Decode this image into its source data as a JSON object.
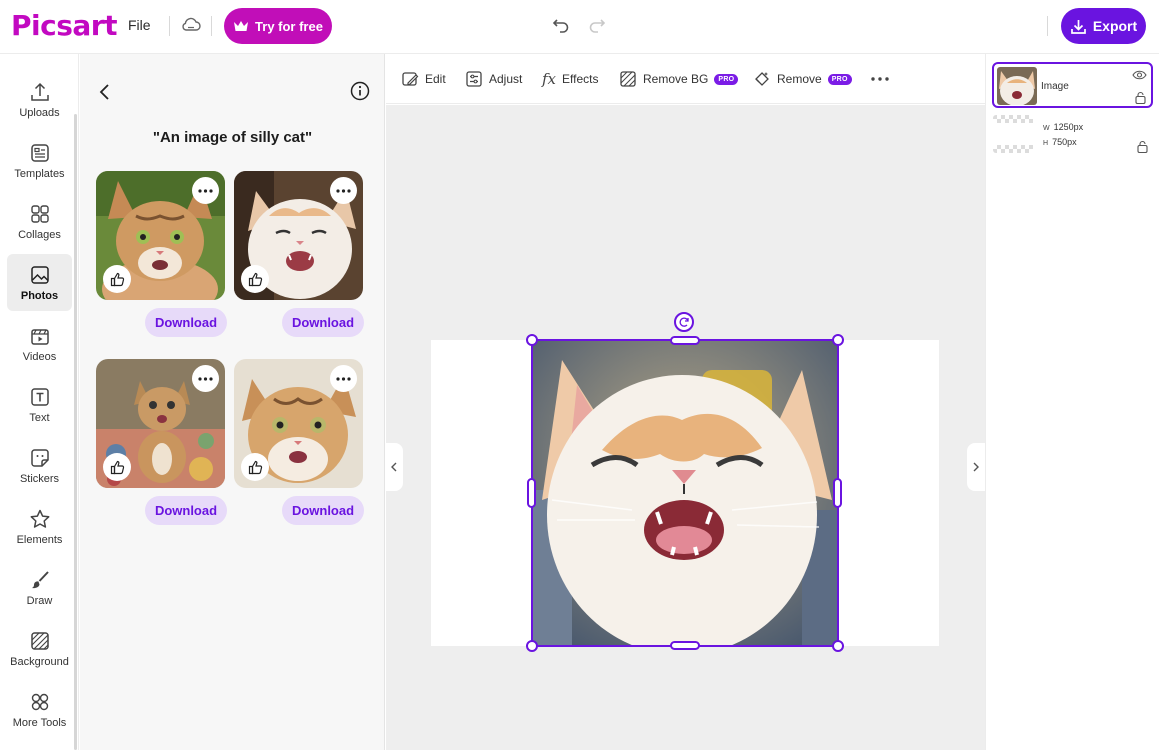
{
  "header": {
    "logo_text": "Picsart",
    "file_label": "File",
    "try_label": "Try for free",
    "export_label": "Export"
  },
  "rail": {
    "items": [
      {
        "label": "Uploads",
        "icon": "upload-icon"
      },
      {
        "label": "Templates",
        "icon": "templates-icon"
      },
      {
        "label": "Collages",
        "icon": "collages-icon"
      },
      {
        "label": "Photos",
        "icon": "photos-icon",
        "active": true
      },
      {
        "label": "Videos",
        "icon": "videos-icon"
      },
      {
        "label": "Text",
        "icon": "text-icon"
      },
      {
        "label": "Stickers",
        "icon": "stickers-icon"
      },
      {
        "label": "Elements",
        "icon": "star-icon"
      },
      {
        "label": "Draw",
        "icon": "brush-icon"
      },
      {
        "label": "Background",
        "icon": "background-icon"
      },
      {
        "label": "More Tools",
        "icon": "more-tools-icon"
      }
    ]
  },
  "panel": {
    "prompt": "\"An image of silly cat\"",
    "download_label": "Download",
    "results": [
      {
        "name": "cat-result-1"
      },
      {
        "name": "cat-result-2"
      },
      {
        "name": "cat-result-3"
      },
      {
        "name": "cat-result-4"
      }
    ]
  },
  "toolbar": {
    "edit": "Edit",
    "adjust": "Adjust",
    "effects": "Effects",
    "remove_bg": "Remove BG",
    "remove": "Remove",
    "pro_badge": "PRO"
  },
  "layers": {
    "image_label": "Image",
    "width_label": "W",
    "height_label": "H",
    "width_value": "1250px",
    "height_value": "750px"
  },
  "colors": {
    "brand_magenta": "#c10eb8",
    "accent_purple": "#6a14e0",
    "download_bg": "#e7daf9"
  }
}
